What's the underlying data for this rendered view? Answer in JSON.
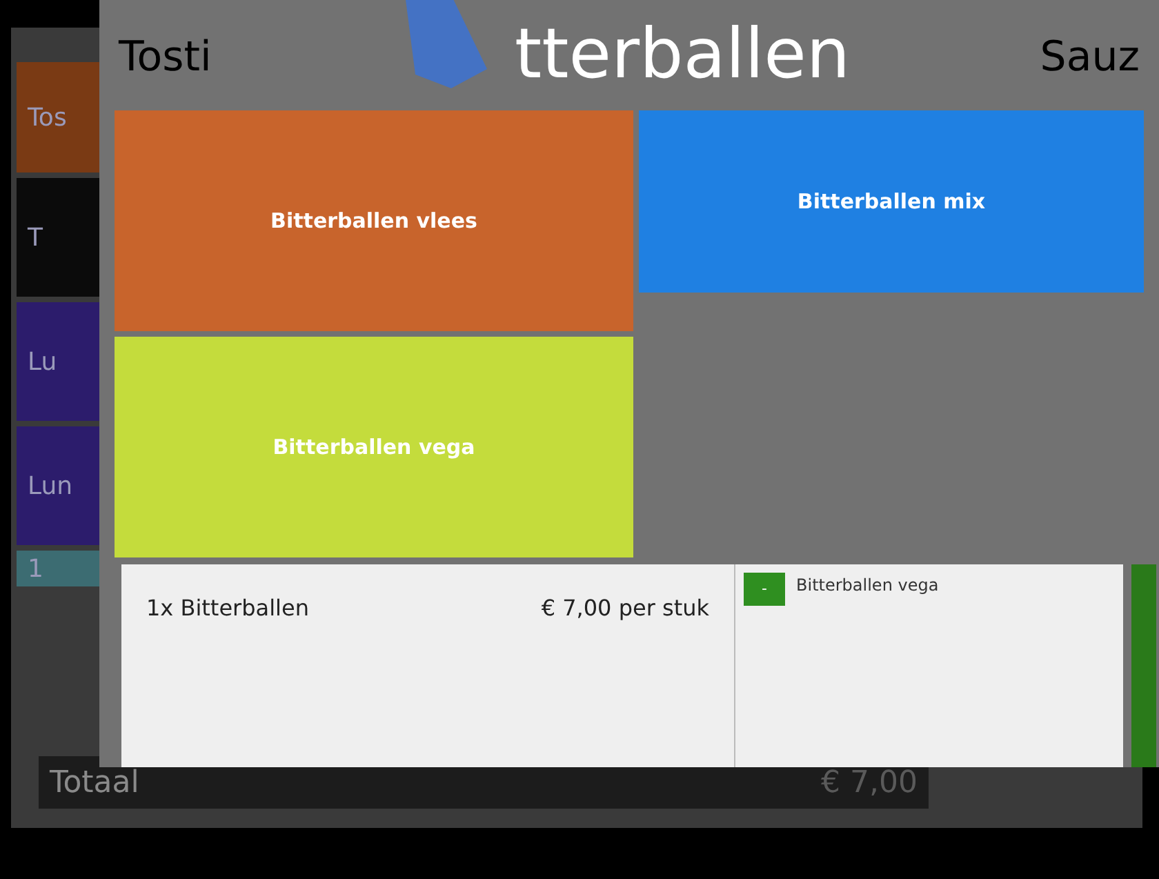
{
  "header": {
    "left_tab": "Tosti",
    "title": "tterballen",
    "right_tab": "Sauz"
  },
  "sidebar": {
    "items": [
      {
        "label": "Tos",
        "color": "#7a3a14"
      },
      {
        "label": "T",
        "color": "#0b0b0b"
      },
      {
        "label": "Lu",
        "color": "#2c1c6c"
      },
      {
        "label": "Lun",
        "color": "#2c1c6c"
      },
      {
        "label": "1",
        "color": "#3c6c72"
      }
    ]
  },
  "products": [
    {
      "label": "Bitterballen vlees",
      "color": "#c8642c"
    },
    {
      "label": "Bitterballen mix",
      "color": "#1f80e2"
    },
    {
      "label": "Bitterballen vega",
      "color": "#c4dc3c"
    }
  ],
  "order": {
    "line": "1x Bitterballen",
    "price": "€ 7,00 per stuk",
    "options": [
      {
        "button": "-",
        "label": "Bitterballen vega"
      }
    ]
  },
  "total": {
    "label": "Totaal",
    "amount": "€ 7,00"
  }
}
